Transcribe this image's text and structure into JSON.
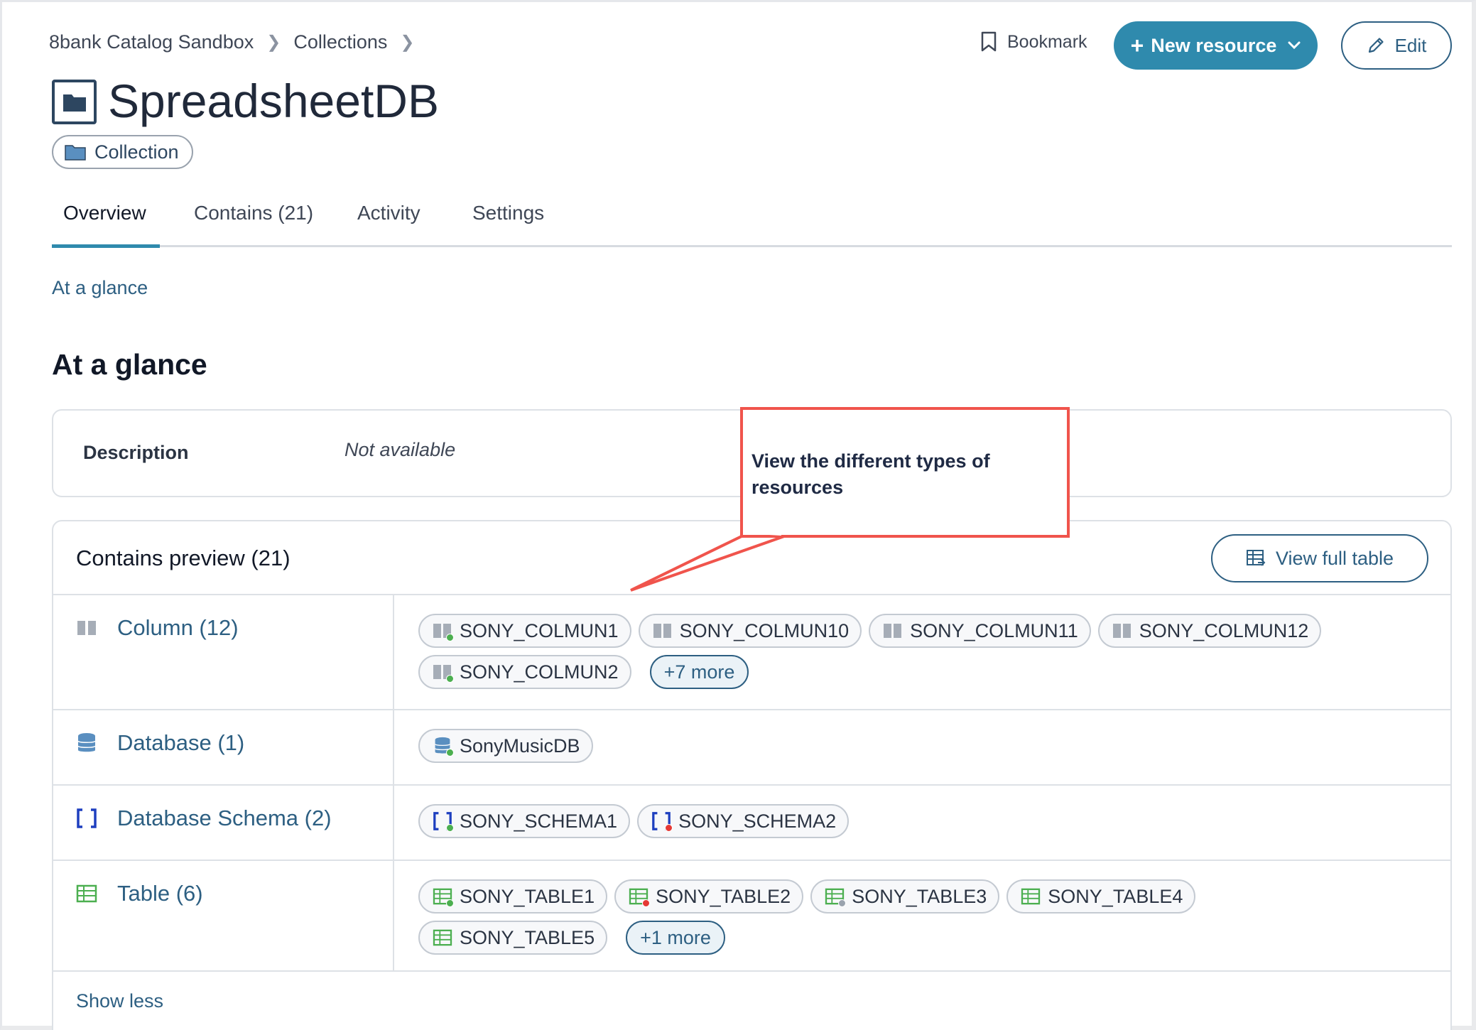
{
  "breadcrumb": {
    "root": "8bank Catalog Sandbox",
    "parent": "Collections"
  },
  "header": {
    "title": "SpreadsheetDB",
    "type_badge": "Collection",
    "bookmark_label": "Bookmark",
    "new_resource_label": "New resource",
    "edit_label": "Edit"
  },
  "tabs": [
    {
      "label": "Overview"
    },
    {
      "label": "Contains (21)"
    },
    {
      "label": "Activity"
    },
    {
      "label": "Settings"
    }
  ],
  "anchor_link": "At a glance",
  "section_title": "At a glance",
  "description": {
    "label": "Description",
    "value": "Not available"
  },
  "contains": {
    "title": "Contains preview (21)",
    "view_full_table_label": "View full table",
    "show_less_label": "Show less",
    "rows": [
      {
        "label": "Column (12)",
        "icon": "column-icon",
        "chips": [
          {
            "label": "SONY_COLMUN1",
            "status": "#4caf50"
          },
          {
            "label": "SONY_COLMUN10",
            "status": ""
          },
          {
            "label": "SONY_COLMUN11",
            "status": ""
          },
          {
            "label": "SONY_COLMUN12",
            "status": ""
          },
          {
            "label": "SONY_COLMUN2",
            "status": "#4caf50"
          }
        ],
        "more": "+7 more"
      },
      {
        "label": "Database (1)",
        "icon": "database-icon",
        "chips": [
          {
            "label": "SonyMusicDB",
            "status": "#4caf50"
          }
        ],
        "more": ""
      },
      {
        "label": "Database Schema (2)",
        "icon": "schema-brackets-icon",
        "chips": [
          {
            "label": "SONY_SCHEMA1",
            "status": "#4caf50"
          },
          {
            "label": "SONY_SCHEMA2",
            "status": "#e53935"
          }
        ],
        "more": ""
      },
      {
        "label": "Table (6)",
        "icon": "table-grid-icon",
        "chips": [
          {
            "label": "SONY_TABLE1",
            "status": "#4caf50"
          },
          {
            "label": "SONY_TABLE2",
            "status": "#e53935"
          },
          {
            "label": "SONY_TABLE3",
            "status": "#9aa3ae"
          },
          {
            "label": "SONY_TABLE4",
            "status": ""
          },
          {
            "label": "SONY_TABLE5",
            "status": ""
          }
        ],
        "more": "+1 more"
      }
    ]
  },
  "annotation": {
    "text": "View the different types of resources",
    "color": "#f0544c"
  },
  "colors": {
    "accent": "#2f8aad",
    "link": "#2d5f82"
  }
}
